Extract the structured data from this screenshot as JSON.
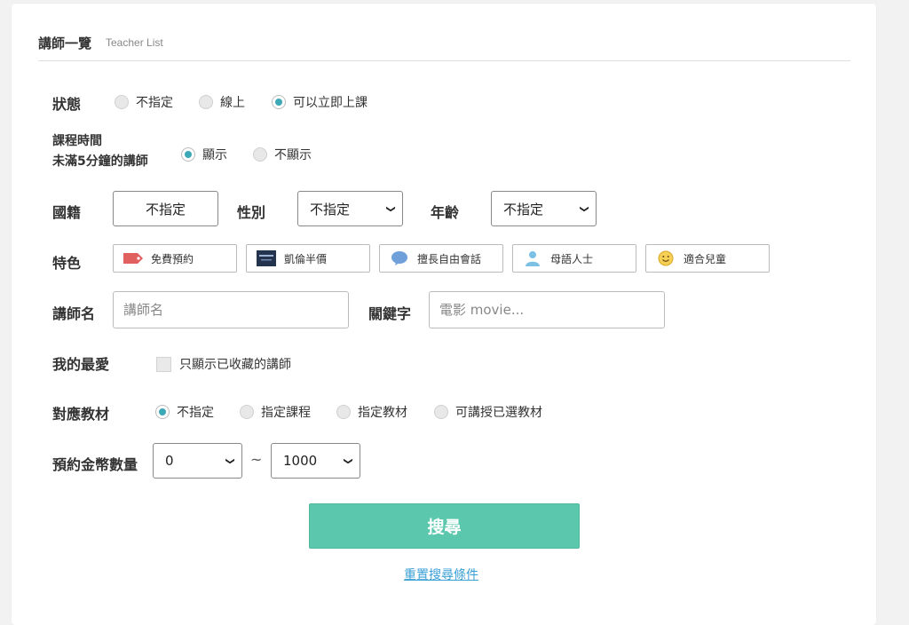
{
  "header": {
    "title": "講師一覽",
    "subtitle": "Teacher List"
  },
  "status": {
    "label": "狀態",
    "options": [
      {
        "label": "不指定",
        "selected": false
      },
      {
        "label": "線上",
        "selected": false
      },
      {
        "label": "可以立即上課",
        "selected": true
      }
    ]
  },
  "lesson_time": {
    "label_line1": "課程時間",
    "label_line2": "未滿5分鐘的講師",
    "options": [
      {
        "label": "顯示",
        "selected": true
      },
      {
        "label": "不顯示",
        "selected": false
      }
    ]
  },
  "nationality": {
    "label": "國籍",
    "value": "不指定"
  },
  "gender": {
    "label": "性別",
    "value": "不指定"
  },
  "age": {
    "label": "年齡",
    "value": "不指定"
  },
  "features": {
    "label": "特色",
    "items": [
      {
        "label": "免費預約",
        "icon": "tag-icon"
      },
      {
        "label": "凱倫半價",
        "icon": "book-cover-icon"
      },
      {
        "label": "擅長自由會話",
        "icon": "speech-bubble-icon"
      },
      {
        "label": "母語人士",
        "icon": "person-icon"
      },
      {
        "label": "適合兒童",
        "icon": "smiley-icon"
      }
    ]
  },
  "teacher_name": {
    "label": "講師名",
    "placeholder": "講師名"
  },
  "keyword": {
    "label": "關鍵字",
    "placeholder": "電影 movie..."
  },
  "favorites": {
    "label": "我的最愛",
    "checkbox_label": "只顯示已收藏的講師",
    "checked": false
  },
  "materials": {
    "label": "對應教材",
    "options": [
      {
        "label": "不指定",
        "selected": true
      },
      {
        "label": "指定課程",
        "selected": false
      },
      {
        "label": "指定教材",
        "selected": false
      },
      {
        "label": "可講授已選教材",
        "selected": false
      }
    ]
  },
  "coins": {
    "label": "預約金幣數量",
    "min": "0",
    "separator": "~",
    "max": "1000"
  },
  "search_button": "搜尋",
  "reset_link": "重置搜尋條件",
  "colors": {
    "accent": "#5bc8ae",
    "radio": "#3ea9b6",
    "link": "#3a9fd6"
  }
}
